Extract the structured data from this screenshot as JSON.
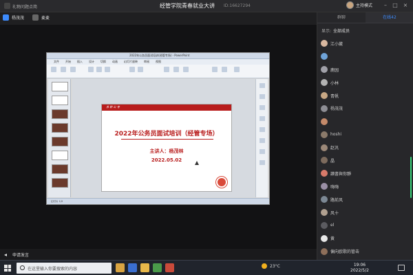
{
  "topbar": {
    "left_label": "礼物问题点简",
    "title": "经管学院青春就业大讲",
    "meeting_id": "ID:16627294",
    "host_mode": "主持模式"
  },
  "speakers": [
    {
      "name": "杨茂茂"
    },
    {
      "name": "麦麦"
    }
  ],
  "ppt": {
    "window_title": "2022年公务员面试培训(经管专场) - PowerPoint",
    "menu": [
      "文件",
      "开始",
      "插入",
      "设计",
      "切换",
      "动画",
      "幻灯片放映",
      "审阅",
      "视图"
    ],
    "slide_banner": "求 职 公 考",
    "slide_title": "2022年公务员面试培训（经管专场）",
    "slide_lecturer": "主讲人：杨茂林",
    "slide_date": "2022.05.02",
    "status_text": "幻灯片 1/9"
  },
  "controls": {
    "speak_request": "申请发言"
  },
  "panel": {
    "tabs": [
      "群聊",
      "在线42"
    ],
    "active_tab": 1,
    "show_label": "显示:",
    "show_value": "全部成员",
    "members": [
      {
        "name": "江小葳",
        "color": "#d9b8a0"
      },
      {
        "name": "",
        "color": "#6fa3d8"
      },
      {
        "name": "鹿园",
        "color": "#a0a0a8"
      },
      {
        "name": "小林",
        "color": "#b3b3b3"
      },
      {
        "name": "青帆",
        "color": "#c7a784"
      },
      {
        "name": "杨茂茂",
        "color": "#8d8d94"
      },
      {
        "name": "",
        "color": "#c48a6a"
      },
      {
        "name": "hoshi",
        "color": "#8b7a6a"
      },
      {
        "name": "赵汎",
        "color": "#9c8878"
      },
      {
        "name": "晶",
        "color": "#7d6b5d"
      },
      {
        "name": "讀書與你靜",
        "color": "#d87a6a"
      },
      {
        "name": "嗨嗨",
        "color": "#9a8fa5"
      },
      {
        "name": "路前风",
        "color": "#7c8894"
      },
      {
        "name": "风十",
        "color": "#b0a090"
      },
      {
        "name": "el",
        "color": "#5b5b60"
      },
      {
        "name": "黄",
        "color": "#e8e8e8"
      },
      {
        "name": "偏向欧歌的管击",
        "color": "#8e6f5a"
      },
      {
        "name": "zyx",
        "color": "#6a7a8a"
      },
      {
        "name": "铭YA令",
        "color": "#a88c78"
      }
    ]
  },
  "taskbar": {
    "search_placeholder": "在这里输入你要搜索的内容",
    "weather": "23°C",
    "time": "19:06",
    "date": "2022/5/2"
  }
}
